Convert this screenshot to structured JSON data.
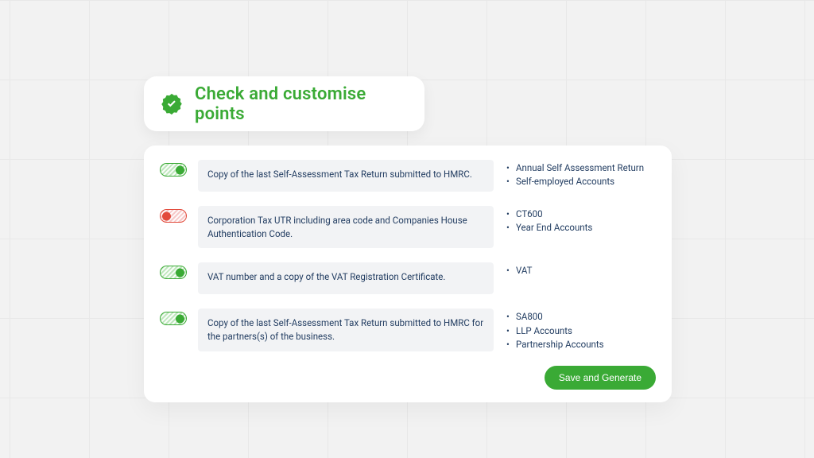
{
  "header": {
    "title": "Check and customise points"
  },
  "rows": [
    {
      "enabled": true,
      "description": "Copy of the last Self-Assessment Tax Return submitted to HMRC.",
      "tags": [
        "Annual Self Assessment Return",
        "Self-employed Accounts"
      ]
    },
    {
      "enabled": false,
      "description": "Corporation Tax UTR including area code and Companies House Authentication Code.",
      "tags": [
        "CT600",
        "Year End Accounts"
      ]
    },
    {
      "enabled": true,
      "description": "VAT number and a copy of the VAT Registration Certificate.",
      "tags": [
        "VAT"
      ]
    },
    {
      "enabled": true,
      "description": "Copy of the last Self-Assessment Tax Return submitted to HMRC for the partners(s) of the business.",
      "tags": [
        "SA800",
        "LLP Accounts",
        "Partnership Accounts"
      ]
    }
  ],
  "actions": {
    "save_label": "Save and Generate"
  },
  "colors": {
    "green": "#3aaa35",
    "red": "#e24a3b",
    "text": "#1f3a5f",
    "panel_bg": "#ffffff",
    "page_bg": "#f2f2f2"
  }
}
